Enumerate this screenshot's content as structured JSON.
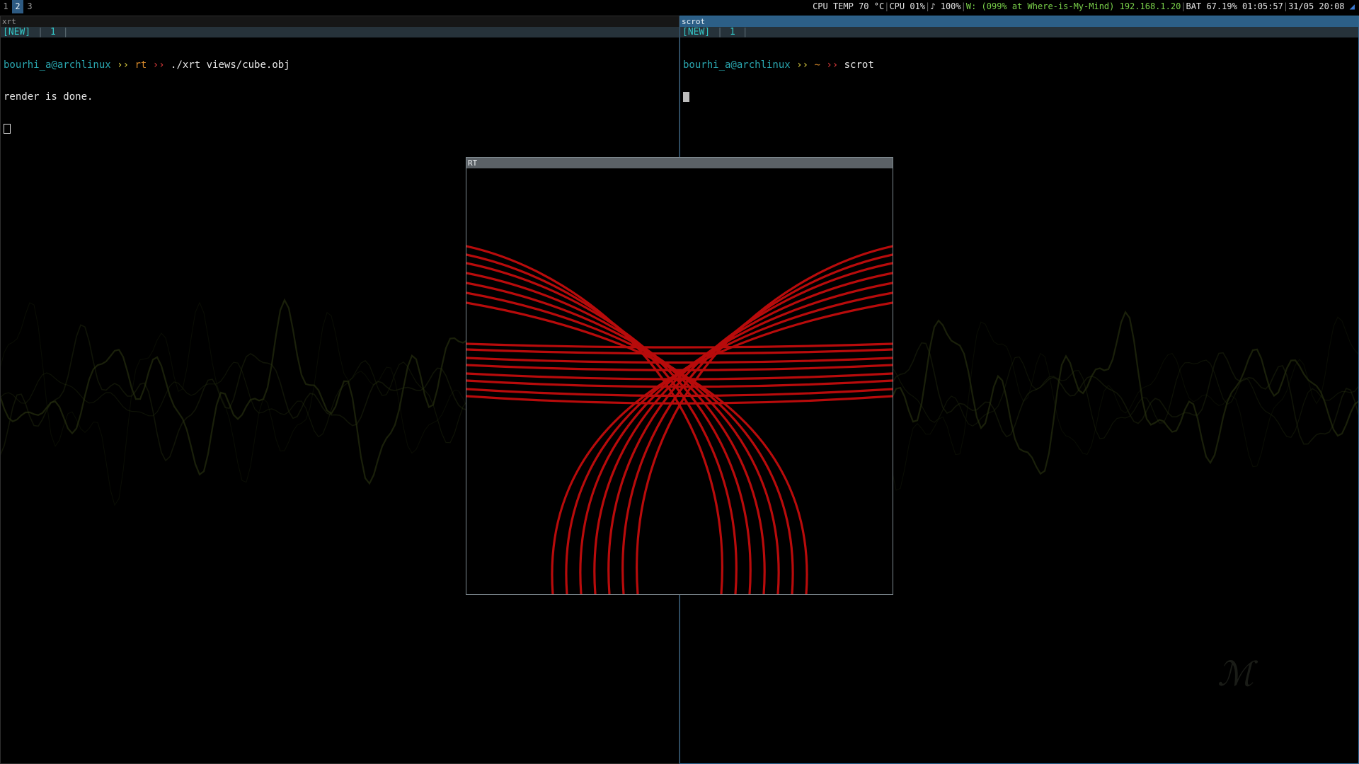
{
  "topbar": {
    "workspaces": [
      "1",
      "2",
      "3"
    ],
    "active_workspace": "2",
    "cpu_temp": "CPU TEMP 70 °C",
    "cpu": "CPU 01%",
    "volume": "♪ 100%",
    "wifi": "W: (099% at Where-is-My-Mind)",
    "ip": "192.168.1.20",
    "battery": "BAT 67.19% 01:05:57",
    "datetime": "31/05 20:08"
  },
  "left_pane": {
    "title": "xrt",
    "tab_new": "[NEW]",
    "tab_index": "1",
    "prompt_user": "bourhi_a@archlinux",
    "prompt_arrow1": "››",
    "prompt_dir": "rt",
    "prompt_arrow2": "››",
    "command": "./xrt views/cube.obj",
    "output": "render is done."
  },
  "right_pane": {
    "title": "scrot",
    "tab_new": "[NEW]",
    "tab_index": "1",
    "prompt_user": "bourhi_a@archlinux",
    "prompt_arrow1": "››",
    "prompt_dir": "~",
    "prompt_arrow2": "››",
    "command": "scrot"
  },
  "rt_window": {
    "title": "RT"
  },
  "colors": {
    "render_stroke": "#b80b0b",
    "wallpaper_wave": "#2f3a13",
    "active_accent": "#2c5f87"
  }
}
